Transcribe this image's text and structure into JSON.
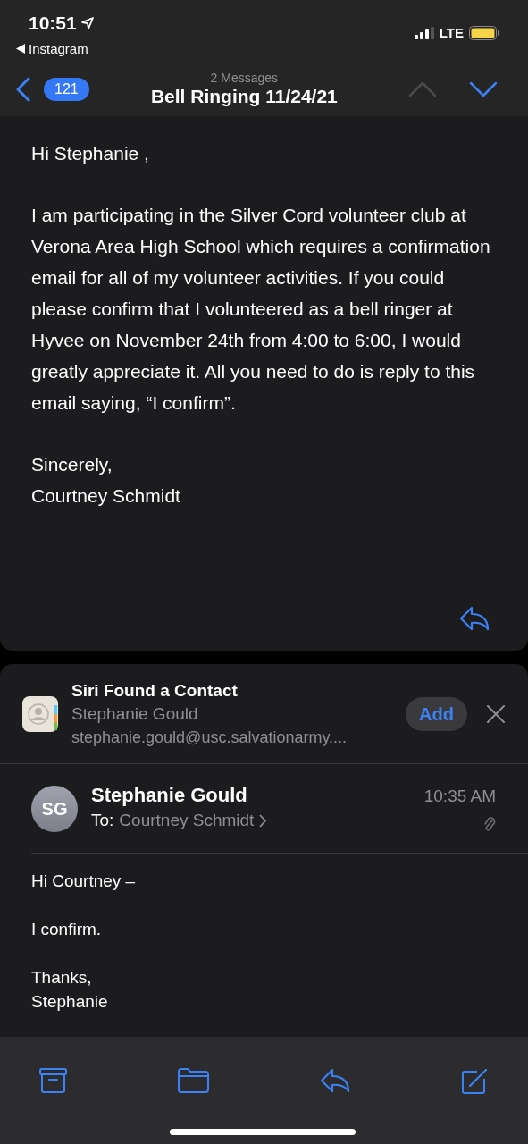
{
  "status_bar": {
    "time": "10:51",
    "back_app": "Instagram",
    "network": "LTE"
  },
  "nav": {
    "unread_count": "121",
    "subtitle": "2 Messages",
    "title": "Bell Ringing 11/24/21",
    "arrows": [
      {
        "kind": "up",
        "disabled": true
      },
      {
        "kind": "down",
        "disabled": false
      }
    ]
  },
  "first_message": {
    "paragraphs": [
      "Hi Stephanie ,",
      "I am participating in the Silver Cord volunteer club at Verona Area High School which requires a confirmation email for all of my volunteer activities. If you could please confirm that I volunteered as a bell ringer at Hyvee on November 24th from 4:00 to 6:00, I would greatly appreciate it. All you need to do is reply to this email saying, “I confirm”.",
      "Sincerely,\nCourtney Schmidt"
    ]
  },
  "siri_contact": {
    "title": "Siri Found a Contact",
    "name": "Stephanie Gould",
    "email": "stephanie.gould@usc.salvationarmy....",
    "button": "Add"
  },
  "second_message": {
    "initials": "SG",
    "sender": "Stephanie Gould",
    "to_label": "To:",
    "recipient": "Courtney Schmidt",
    "time": "10:35 AM",
    "has_attachment": true,
    "paragraphs": [
      "Hi Courtney –",
      "I confirm.",
      "Thanks,\nStephanie"
    ]
  }
}
